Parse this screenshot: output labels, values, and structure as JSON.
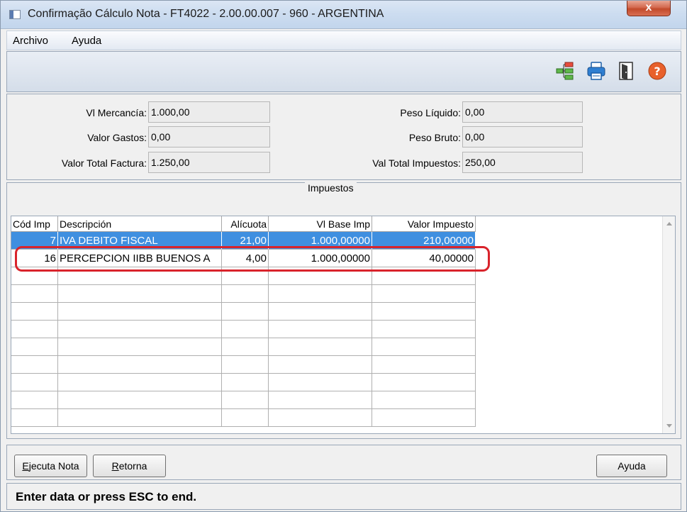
{
  "window": {
    "title": "Confirmação Cálculo Nota - FT4022 - 2.00.00.007 - 960 - ARGENTINA",
    "close_label": "x"
  },
  "menu": [
    "Archivo",
    "Ayuda"
  ],
  "toolbar": {
    "icons": [
      "tree-structure-icon",
      "printer-icon",
      "exit-door-icon",
      "help-icon"
    ]
  },
  "totals": {
    "vl_mercancia": {
      "label": "Vl Mercancía:",
      "value": "1.000,00"
    },
    "valor_gastos": {
      "label": "Valor Gastos:",
      "value": "0,00"
    },
    "valor_total_factura": {
      "label": "Valor Total Factura:",
      "value": "1.250,00"
    },
    "peso_liquido": {
      "label": "Peso Líquido:",
      "value": "0,00"
    },
    "peso_bruto": {
      "label": "Peso Bruto:",
      "value": "0,00"
    },
    "val_total_impuestos": {
      "label": "Val Total Impuestos:",
      "value": "250,00"
    }
  },
  "taxes": {
    "group_title": "Impuestos",
    "columns": [
      "Cód Imp",
      "Descripción",
      "Alícuota",
      "Vl Base Imp",
      "Valor Impuesto"
    ],
    "rows": [
      [
        "7",
        "IVA DEBITO FISCAL",
        "21,00",
        "1.000,00000",
        "210,00000"
      ],
      [
        "16",
        "PERCEPCION IIBB BUENOS A",
        "4,00",
        "1.000,00000",
        "40,00000"
      ]
    ]
  },
  "buttons": {
    "ejecuta_nota": {
      "mnemonic": "E",
      "rest": "jecuta Nota"
    },
    "retorna": {
      "mnemonic": "R",
      "rest": "etorna"
    },
    "ayuda": "Ayuda"
  },
  "status": "Enter data or press ESC to end.",
  "colors": {
    "selection": "#3f8fe0",
    "annotation": "#d9232b"
  }
}
